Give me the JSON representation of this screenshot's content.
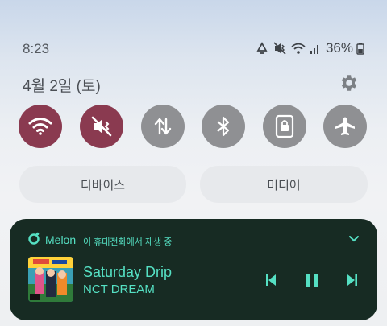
{
  "status_bar": {
    "time": "8:23",
    "battery": "36%"
  },
  "date": "4월 2일 (토)",
  "quick_tiles": [
    {
      "name": "wifi",
      "active": true
    },
    {
      "name": "mute-vibrate",
      "active": true
    },
    {
      "name": "mobile-data",
      "active": false
    },
    {
      "name": "bluetooth",
      "active": false
    },
    {
      "name": "screen-lock",
      "active": false
    },
    {
      "name": "airplane-mode",
      "active": false
    }
  ],
  "buttons": {
    "devices": "디바이스",
    "media": "미디어"
  },
  "media_player": {
    "app": "Melon",
    "subtitle": "이 휴대전화에서 재생 중",
    "song_title": "Saturday Drip",
    "artist": "NCT DREAM",
    "accent_color": "#55e0c3",
    "background_color": "#172b23"
  },
  "colors": {
    "tile_on": "#8a3a50",
    "tile_off": "#8f9093"
  }
}
